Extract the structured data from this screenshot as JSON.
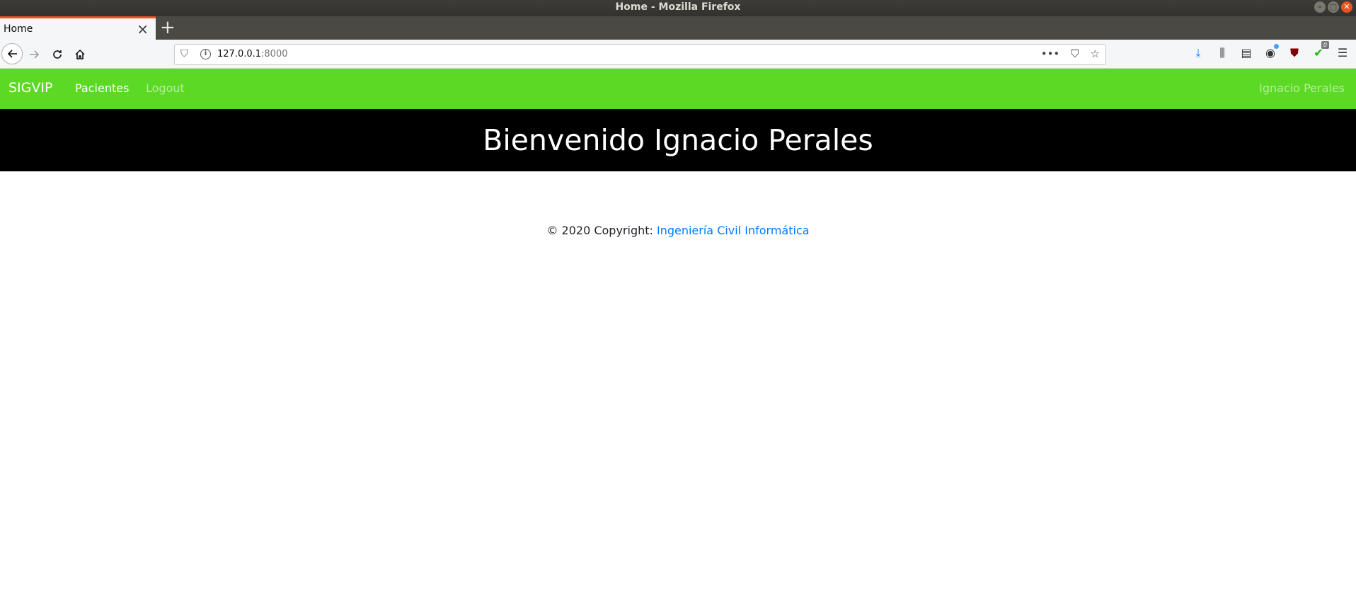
{
  "window": {
    "title": "Home - Mozilla Firefox"
  },
  "browser": {
    "tab": {
      "title": "Home"
    },
    "url": {
      "host": "127.0.0.1",
      "port": ":8000"
    }
  },
  "site": {
    "brand": "SIGVIP",
    "nav": {
      "pacientes": "Pacientes",
      "logout": "Logout",
      "user": "Ignacio Perales"
    },
    "hero_title": "Bienvenido Ignacio Perales",
    "footer": {
      "copyright": "© 2020 Copyright: ",
      "link": "Ingeniería Civil Informática"
    },
    "colors": {
      "navbar": "#5cd925",
      "hero": "#000000",
      "link": "#007bff"
    }
  },
  "toolbar_badge": "0"
}
